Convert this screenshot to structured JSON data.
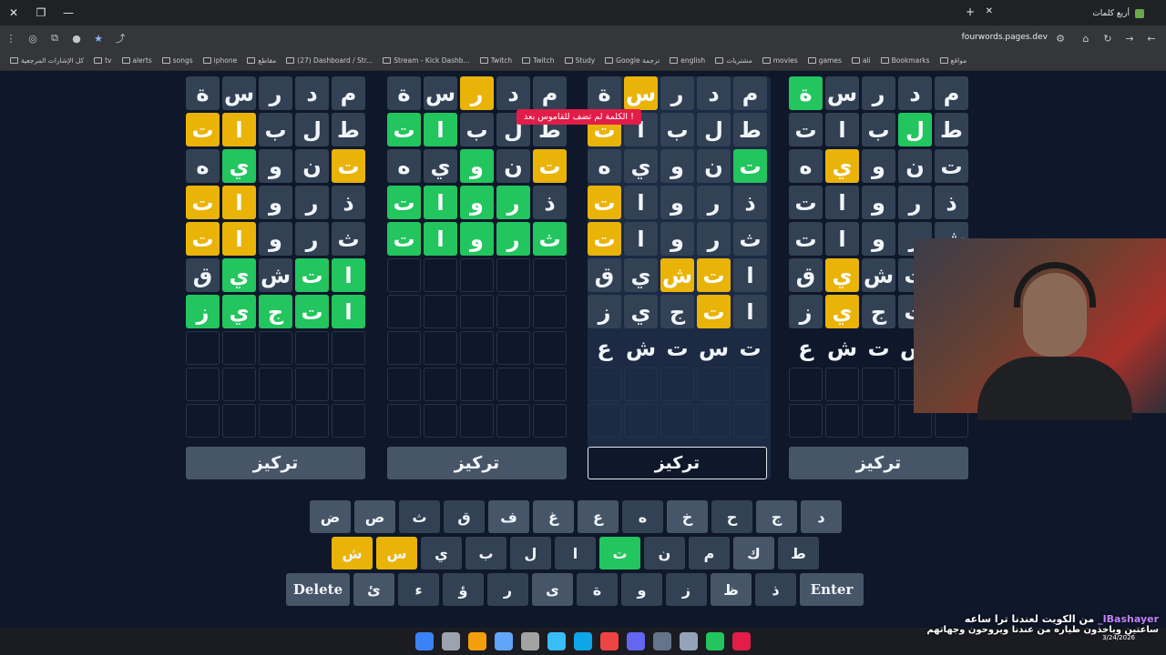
{
  "browser": {
    "tab_title": "أربع كلمات",
    "url": "fourwords.pages.dev",
    "bookmarks": [
      "كل الإشارات المرجعية",
      "tv",
      "alerts",
      "songs",
      "iphone",
      "مقاطع",
      "(27) Dashboard / Str...",
      "Stream - Kick Dashb...",
      "Twitch",
      "Twitch",
      "Study",
      "Google ترجمة",
      "english",
      "مشتريات",
      "movies",
      "games",
      "ali",
      "Bookmarks",
      "مواقع"
    ]
  },
  "toast": "الكلمة لم تضف للقاموس بعد !",
  "focus_label": "تركيز",
  "boards": [
    {
      "focused": false,
      "rows": [
        [
          "م",
          "د",
          "ر",
          "س",
          "ة"
        ],
        [
          "ط",
          "ل",
          "ب",
          "ا",
          "ت"
        ],
        [
          "ت",
          "ن",
          "و",
          "ي",
          "ه"
        ],
        [
          "ذ",
          "ر",
          "و",
          "ا",
          "ت"
        ],
        [
          "ث",
          "ر",
          "و",
          "ا",
          "ت"
        ],
        [
          "ا",
          "ت",
          "ش",
          "ي",
          "ق"
        ],
        [
          "ا",
          "ت",
          "ج",
          "ي",
          "ز"
        ],
        [
          "",
          "",
          "",
          "",
          ""
        ],
        [
          "",
          "",
          "",
          "",
          ""
        ],
        [
          "",
          "",
          "",
          "",
          ""
        ]
      ],
      "states": [
        [
          "n",
          "n",
          "n",
          "n",
          "n"
        ],
        [
          "n",
          "n",
          "n",
          "y",
          "y"
        ],
        [
          "y",
          "n",
          "n",
          "g",
          "n"
        ],
        [
          "n",
          "n",
          "n",
          "y",
          "y"
        ],
        [
          "n",
          "n",
          "n",
          "y",
          "y"
        ],
        [
          "g",
          "g",
          "n",
          "g",
          "n"
        ],
        [
          "g",
          "g",
          "g",
          "g",
          "g"
        ],
        [
          "e",
          "e",
          "e",
          "e",
          "e"
        ],
        [
          "e",
          "e",
          "e",
          "e",
          "e"
        ],
        [
          "e",
          "e",
          "e",
          "e",
          "e"
        ]
      ]
    },
    {
      "focused": false,
      "rows": [
        [
          "م",
          "د",
          "ر",
          "س",
          "ة"
        ],
        [
          "ط",
          "ل",
          "ب",
          "ا",
          "ت"
        ],
        [
          "ت",
          "ن",
          "و",
          "ي",
          "ه"
        ],
        [
          "ذ",
          "ر",
          "و",
          "ا",
          "ت"
        ],
        [
          "ث",
          "ر",
          "و",
          "ا",
          "ت"
        ],
        [
          "",
          "",
          "",
          "",
          ""
        ],
        [
          "",
          "",
          "",
          "",
          ""
        ],
        [
          "",
          "",
          "",
          "",
          ""
        ],
        [
          "",
          "",
          "",
          "",
          ""
        ],
        [
          "",
          "",
          "",
          "",
          ""
        ]
      ],
      "states": [
        [
          "n",
          "n",
          "y",
          "n",
          "n"
        ],
        [
          "n",
          "n",
          "n",
          "g",
          "g"
        ],
        [
          "y",
          "n",
          "g",
          "n",
          "n"
        ],
        [
          "n",
          "g",
          "g",
          "g",
          "g"
        ],
        [
          "g",
          "g",
          "g",
          "g",
          "g"
        ],
        [
          "e",
          "e",
          "e",
          "e",
          "e"
        ],
        [
          "e",
          "e",
          "e",
          "e",
          "e"
        ],
        [
          "e",
          "e",
          "e",
          "e",
          "e"
        ],
        [
          "e",
          "e",
          "e",
          "e",
          "e"
        ],
        [
          "e",
          "e",
          "e",
          "e",
          "e"
        ]
      ]
    },
    {
      "focused": true,
      "rows": [
        [
          "م",
          "د",
          "ر",
          "س",
          "ة"
        ],
        [
          "ط",
          "ل",
          "ب",
          "ا",
          "ت"
        ],
        [
          "ت",
          "ن",
          "و",
          "ي",
          "ه"
        ],
        [
          "ذ",
          "ر",
          "و",
          "ا",
          "ت"
        ],
        [
          "ث",
          "ر",
          "و",
          "ا",
          "ت"
        ],
        [
          "ا",
          "ت",
          "ش",
          "ي",
          "ق"
        ],
        [
          "ا",
          "ت",
          "ج",
          "ي",
          "ز"
        ],
        [
          "ت",
          "س",
          "ت",
          "ش",
          "ع"
        ],
        [
          "",
          "",
          "",
          "",
          ""
        ],
        [
          "",
          "",
          "",
          "",
          ""
        ]
      ],
      "states": [
        [
          "n",
          "n",
          "n",
          "y",
          "n"
        ],
        [
          "n",
          "n",
          "n",
          "n",
          "y"
        ],
        [
          "g",
          "n",
          "n",
          "n",
          "n"
        ],
        [
          "n",
          "n",
          "n",
          "n",
          "y"
        ],
        [
          "n",
          "n",
          "n",
          "n",
          "y"
        ],
        [
          "n",
          "y",
          "y",
          "n",
          "n"
        ],
        [
          "n",
          "y",
          "n",
          "n",
          "n"
        ],
        [
          "t",
          "t",
          "t",
          "t",
          "t"
        ],
        [
          "e",
          "e",
          "e",
          "e",
          "e"
        ],
        [
          "e",
          "e",
          "e",
          "e",
          "e"
        ]
      ]
    },
    {
      "focused": false,
      "rows": [
        [
          "م",
          "د",
          "ر",
          "س",
          "ة"
        ],
        [
          "ط",
          "ل",
          "ب",
          "ا",
          "ت"
        ],
        [
          "ت",
          "ن",
          "و",
          "ي",
          "ه"
        ],
        [
          "ذ",
          "ر",
          "و",
          "ا",
          "ت"
        ],
        [
          "ش",
          "ر",
          "و",
          "ا",
          "ت"
        ],
        [
          "ت",
          "ت",
          "ش",
          "ي",
          "ق"
        ],
        [
          "ت",
          "ت",
          "ج",
          "ي",
          "ز"
        ],
        [
          "س",
          "س",
          "ت",
          "ش",
          "ع"
        ],
        [
          "",
          "",
          "",
          "",
          ""
        ],
        [
          "",
          "",
          "",
          "",
          ""
        ]
      ],
      "states": [
        [
          "n",
          "n",
          "n",
          "n",
          "g"
        ],
        [
          "n",
          "g",
          "n",
          "n",
          "n"
        ],
        [
          "n",
          "n",
          "n",
          "y",
          "n"
        ],
        [
          "n",
          "n",
          "n",
          "n",
          "n"
        ],
        [
          "n",
          "n",
          "n",
          "n",
          "n"
        ],
        [
          "n",
          "n",
          "n",
          "y",
          "n"
        ],
        [
          "n",
          "n",
          "n",
          "y",
          "n"
        ],
        [
          "t",
          "t",
          "t",
          "t",
          "t"
        ],
        [
          "e",
          "e",
          "e",
          "e",
          "e"
        ],
        [
          "e",
          "e",
          "e",
          "e",
          "e"
        ]
      ]
    }
  ],
  "keyboard": {
    "row1": [
      {
        "k": "د",
        "s": "used"
      },
      {
        "k": "ج",
        "s": "used"
      },
      {
        "k": "ح",
        "s": "plain"
      },
      {
        "k": "خ",
        "s": "used"
      },
      {
        "k": "ه",
        "s": "plain"
      },
      {
        "k": "ع",
        "s": "used"
      },
      {
        "k": "غ",
        "s": "used"
      },
      {
        "k": "ف",
        "s": "used"
      },
      {
        "k": "ق",
        "s": "plain"
      },
      {
        "k": "ث",
        "s": "plain"
      },
      {
        "k": "ص",
        "s": "used"
      },
      {
        "k": "ض",
        "s": "used"
      }
    ],
    "row2": [
      {
        "k": "ط",
        "s": "plain"
      },
      {
        "k": "ك",
        "s": "used"
      },
      {
        "k": "م",
        "s": "plain"
      },
      {
        "k": "ن",
        "s": "plain"
      },
      {
        "k": "ت",
        "s": "green"
      },
      {
        "k": "ا",
        "s": "plain"
      },
      {
        "k": "ل",
        "s": "plain"
      },
      {
        "k": "ب",
        "s": "plain"
      },
      {
        "k": "ي",
        "s": "plain"
      },
      {
        "k": "س",
        "s": "yellow"
      },
      {
        "k": "ش",
        "s": "yellow"
      }
    ],
    "row3": [
      {
        "k": "Enter",
        "s": "wide"
      },
      {
        "k": "ذ",
        "s": "plain"
      },
      {
        "k": "ظ",
        "s": "used"
      },
      {
        "k": "ز",
        "s": "plain"
      },
      {
        "k": "و",
        "s": "plain"
      },
      {
        "k": "ة",
        "s": "plain"
      },
      {
        "k": "ى",
        "s": "used"
      },
      {
        "k": "ر",
        "s": "plain"
      },
      {
        "k": "ؤ",
        "s": "plain"
      },
      {
        "k": "ء",
        "s": "plain"
      },
      {
        "k": "ئ",
        "s": "used"
      },
      {
        "k": "Delete",
        "s": "wide"
      }
    ]
  },
  "chat": {
    "user": "_IBashayer",
    "line1": "من الكويت لعندنا ترا ساعه",
    "line2": "ساعتين وياخذون طياره من عندنا ويروحون وجهاتهم"
  },
  "clock": {
    "time": "",
    "date": "3/24/2026"
  }
}
